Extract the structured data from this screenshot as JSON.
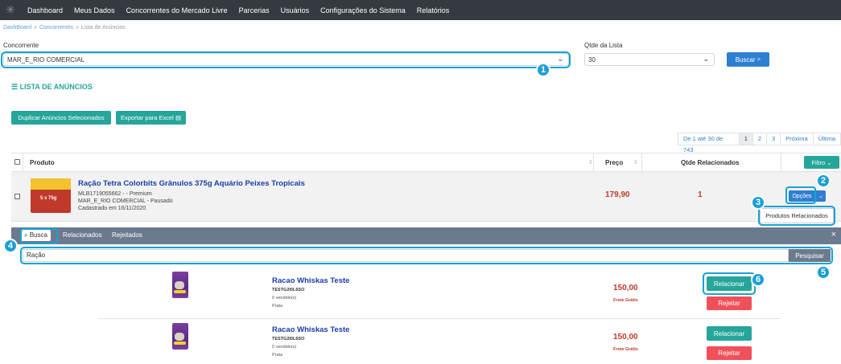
{
  "nav": {
    "items": [
      "Dashboard",
      "Meus Dados",
      "Concorrentes do Mercado Livre",
      "Parcerias",
      "Usuários",
      "Configurações do Sistema",
      "Relatórios"
    ]
  },
  "breadcrumb": {
    "home": "DashBoard",
    "section": "Concorrentes",
    "current": "Lista de Anúncios"
  },
  "filters": {
    "competitor_label": "Concorrente",
    "competitor_value": "MAR_E_RIO COMERCIAL",
    "list_size_label": "Qtde da Lista",
    "list_size_value": "30",
    "search_button": "Buscar"
  },
  "section_title": "LISTA DE ANÚNCIOS",
  "actions": {
    "duplicate": "Duplicar Anúncios Selecionados",
    "export": "Exportar para Excel"
  },
  "pagination": {
    "range": "De 1 até 30 de 743",
    "pages": [
      "1",
      "2",
      "3"
    ],
    "next": "Próxima",
    "last": "Última",
    "active_page": "1"
  },
  "table": {
    "headers": {
      "product": "Produto",
      "price": "Preço",
      "related": "Qtde Relacionados"
    },
    "filter_button": "Filtro"
  },
  "listing": {
    "title": "Ração Tetra Colorbits Grânulos 375g Aquário Peixes Tropicais",
    "sku": "MLB1719055662 - - Premium",
    "seller_status": "MAR_E_RIO COMERCIAL - Pausado",
    "created": "Cadastrado em 16/11/2020",
    "image_label": "5 x 75g",
    "price": "179,90",
    "related_count": "1",
    "options_button": "Opções",
    "dropdown_item": "Produtos Relacionados"
  },
  "panel": {
    "tabs": [
      "Busca",
      "Relacionados",
      "Rejeitados"
    ],
    "close": "×",
    "search_value": "Ração",
    "search_button": "Pesquisar"
  },
  "results": [
    {
      "name": "Racao Whiskas Teste",
      "sku": "TESTG2I0L6SO",
      "sold": "0 vendido(s)",
      "tier": "Prata",
      "price": "150,00",
      "shipping": "Frete Grátis",
      "relate_button": "Relacionar",
      "reject_button": "Rejeitar"
    },
    {
      "name": "Racao Whiskas Teste",
      "sku": "TESTG2I0L6SO",
      "sold": "0 vendido(s)",
      "tier": "Prata",
      "price": "150,00",
      "shipping": "Frete Grátis",
      "relate_button": "Relacionar",
      "reject_button": "Rejeitar"
    }
  ],
  "callouts": [
    "1",
    "2",
    "3",
    "4",
    "5",
    "6"
  ],
  "colors": {
    "nav_bg": "#343a40",
    "accent_teal": "#26a69a",
    "accent_blue": "#2f7fd1",
    "callout": "#1b9fd6",
    "price_red": "#c0392b",
    "reject_red": "#f0505a"
  }
}
